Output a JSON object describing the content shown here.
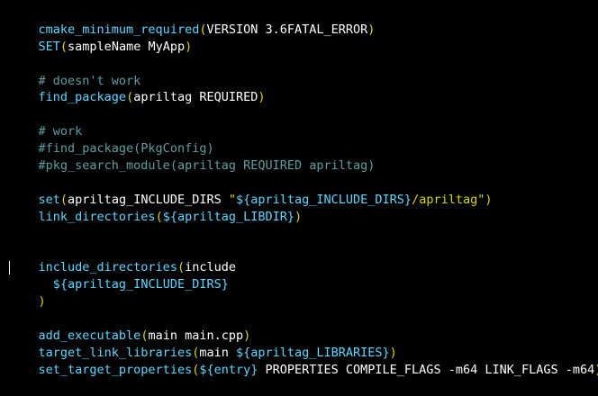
{
  "colors": {
    "background": "#000000",
    "function": "#5fd7ff",
    "paren": "#d7d700",
    "default": "#ffffff",
    "comment": "#5f9ea0",
    "variable": "#5fd7ff",
    "string": "#d7d700"
  },
  "lines": [
    [
      [
        "fn",
        "cmake_minimum_required"
      ],
      [
        "pn",
        "("
      ],
      [
        "df",
        "VERSION 3.6FATAL_ERROR"
      ],
      [
        "pn",
        ")"
      ]
    ],
    [
      [
        "fn",
        "SET"
      ],
      [
        "pn",
        "("
      ],
      [
        "df",
        "sampleName MyApp"
      ],
      [
        "pn",
        ")"
      ]
    ],
    [],
    [
      [
        "cm",
        "# doesn't work"
      ]
    ],
    [
      [
        "fn",
        "find_package"
      ],
      [
        "pn",
        "("
      ],
      [
        "df",
        "apriltag REQUIRED"
      ],
      [
        "pn",
        ")"
      ]
    ],
    [],
    [
      [
        "cm",
        "# work"
      ]
    ],
    [
      [
        "cm",
        "#find_package(PkgConfig)"
      ]
    ],
    [
      [
        "cm",
        "#pkg_search_module(apriltag REQUIRED apriltag)"
      ]
    ],
    [],
    [
      [
        "fn",
        "set"
      ],
      [
        "pn",
        "("
      ],
      [
        "df",
        "apriltag_INCLUDE_DIRS "
      ],
      [
        "st",
        "\""
      ],
      [
        "vr",
        "${apriltag_INCLUDE_DIRS}"
      ],
      [
        "st",
        "/apriltag\""
      ],
      [
        "pn",
        ")"
      ]
    ],
    [
      [
        "fn",
        "link_directories"
      ],
      [
        "pn",
        "("
      ],
      [
        "vr",
        "${apriltag_LIBDIR}"
      ],
      [
        "pn",
        ")"
      ]
    ],
    [],
    [],
    [
      [
        "fn",
        "include_directories"
      ],
      [
        "pn",
        "("
      ],
      [
        "df",
        "include"
      ]
    ],
    [
      [
        "df",
        "  "
      ],
      [
        "vr",
        "${apriltag_INCLUDE_DIRS}"
      ]
    ],
    [
      [
        "pn",
        ")"
      ]
    ],
    [],
    [
      [
        "fn",
        "add_executable"
      ],
      [
        "pn",
        "("
      ],
      [
        "df",
        "main main.cpp"
      ],
      [
        "pn",
        ")"
      ]
    ],
    [
      [
        "fn",
        "target_link_libraries"
      ],
      [
        "pn",
        "("
      ],
      [
        "df",
        "main "
      ],
      [
        "vr",
        "${apriltag_LIBRARIES}"
      ],
      [
        "pn",
        ")"
      ]
    ],
    [
      [
        "fn",
        "set_target_properties"
      ],
      [
        "pn",
        "("
      ],
      [
        "vr",
        "${entry}"
      ],
      [
        "df",
        " PROPERTIES COMPILE_FLAGS -m64 LINK_FLAGS -m64"
      ],
      [
        "pn",
        ")"
      ]
    ]
  ]
}
